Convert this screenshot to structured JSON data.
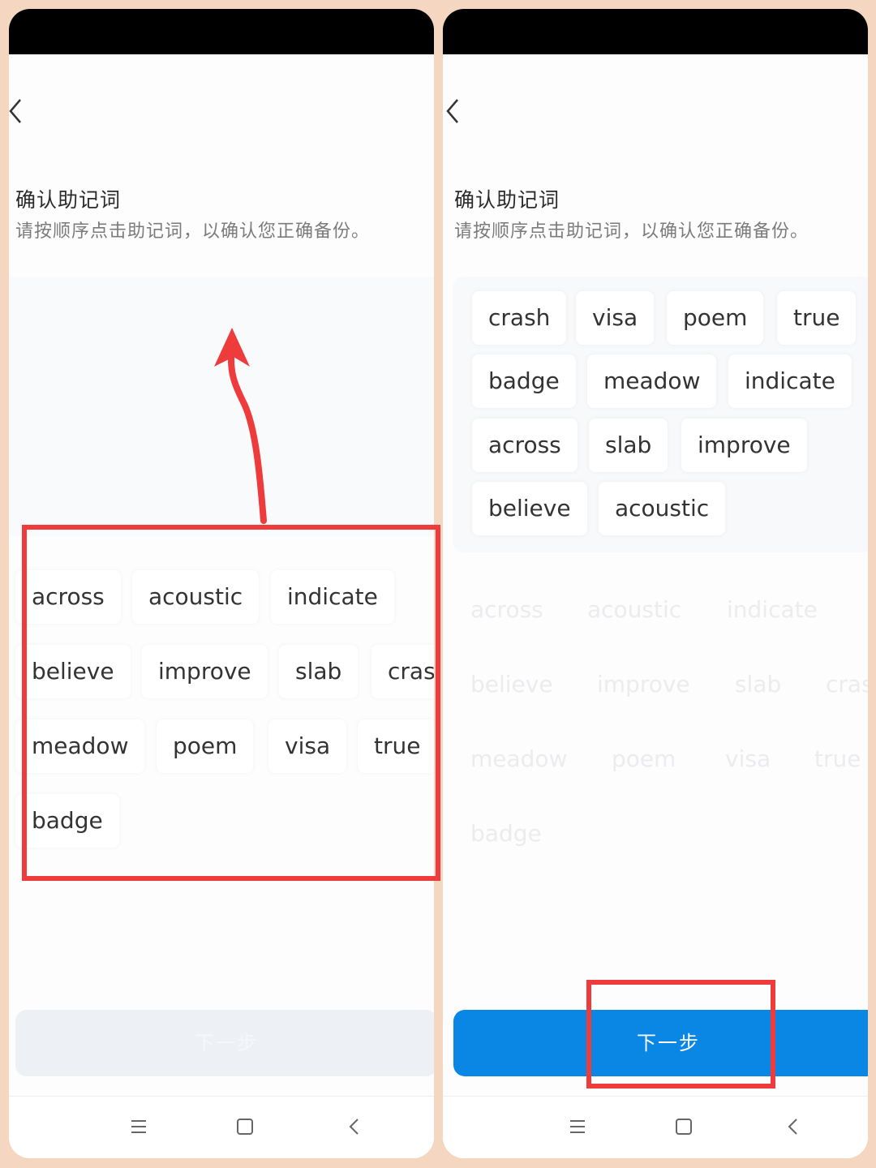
{
  "screens": [
    {
      "state": "before",
      "title": "确认助记词",
      "subtitle": "请按顺序点击助记词，以确认您正确备份。",
      "selected_words": [],
      "word_pool": [
        {
          "word": "across",
          "used": false
        },
        {
          "word": "acoustic",
          "used": false
        },
        {
          "word": "indicate",
          "used": false
        },
        {
          "word": "believe",
          "used": false
        },
        {
          "word": "improve",
          "used": false
        },
        {
          "word": "slab",
          "used": false
        },
        {
          "word": "crash",
          "used": false
        },
        {
          "word": "meadow",
          "used": false
        },
        {
          "word": "poem",
          "used": false
        },
        {
          "word": "visa",
          "used": false
        },
        {
          "word": "true",
          "used": false
        },
        {
          "word": "badge",
          "used": false
        }
      ],
      "next_button": {
        "label": "下一步",
        "enabled": false
      }
    },
    {
      "state": "after",
      "title": "确认助记词",
      "subtitle": "请按顺序点击助记词，以确认您正确备份。",
      "selected_words": [
        "crash",
        "visa",
        "poem",
        "true",
        "badge",
        "meadow",
        "indicate",
        "across",
        "slab",
        "improve",
        "believe",
        "acoustic"
      ],
      "word_pool": [
        {
          "word": "across",
          "used": true
        },
        {
          "word": "acoustic",
          "used": true
        },
        {
          "word": "indicate",
          "used": true
        },
        {
          "word": "believe",
          "used": true
        },
        {
          "word": "improve",
          "used": true
        },
        {
          "word": "slab",
          "used": true
        },
        {
          "word": "crash",
          "used": true
        },
        {
          "word": "meadow",
          "used": true
        },
        {
          "word": "poem",
          "used": true
        },
        {
          "word": "visa",
          "used": true
        },
        {
          "word": "true",
          "used": true
        },
        {
          "word": "badge",
          "used": true
        }
      ],
      "next_button": {
        "label": "下一步",
        "enabled": true
      }
    }
  ],
  "nav_icons": [
    "menu-icon",
    "home-icon",
    "back-icon"
  ],
  "colors": {
    "accent": "#0a86e5",
    "annotation": "#ee3b3b",
    "disabled_button": "#edf1f6",
    "background": "#f5d6c0"
  }
}
